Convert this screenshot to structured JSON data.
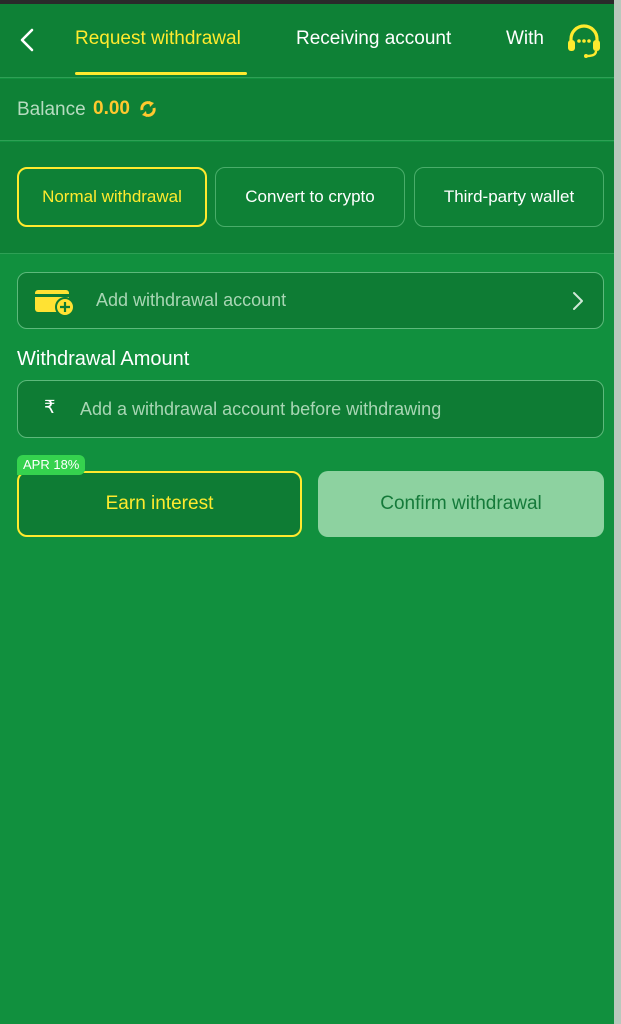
{
  "header": {
    "tabs": [
      {
        "label": "Request withdrawal",
        "active": true
      },
      {
        "label": "Receiving account",
        "active": false
      },
      {
        "label": "With",
        "active": false
      }
    ]
  },
  "balance": {
    "label": "Balance",
    "value": "0.00"
  },
  "methods": [
    {
      "label": "Normal withdrawal",
      "active": true
    },
    {
      "label": "Convert to crypto",
      "active": false
    },
    {
      "label": "Third-party wallet",
      "active": false
    }
  ],
  "add_account": {
    "label": "Add withdrawal account"
  },
  "amount": {
    "title": "Withdrawal Amount",
    "currency_symbol": "₹",
    "placeholder": "Add a withdrawal account before withdrawing",
    "value": ""
  },
  "actions": {
    "apr_badge": "APR 18%",
    "earn_label": "Earn interest",
    "confirm_label": "Confirm withdrawal"
  },
  "colors": {
    "background": "#11903e",
    "header": "#0e8136",
    "accent": "#ffea2e",
    "balance_value": "#ffc82e",
    "confirm_disabled": "#8dd2a0",
    "badge": "#35d24e"
  },
  "icons": [
    "chevron-left-icon",
    "headset-icon",
    "refresh-icon",
    "wallet-add-icon",
    "chevron-right-icon"
  ]
}
